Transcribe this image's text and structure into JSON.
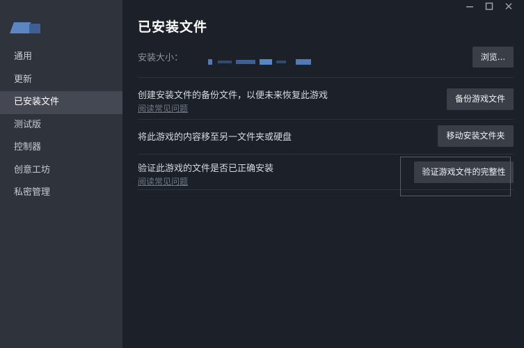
{
  "window": {
    "minimize_icon": "minimize-icon",
    "maximize_icon": "maximize-icon",
    "close_icon": "close-icon"
  },
  "sidebar": {
    "logo_icon": "game-logo-icon",
    "items": [
      {
        "label": "通用",
        "active": false
      },
      {
        "label": "更新",
        "active": false
      },
      {
        "label": "已安装文件",
        "active": true
      },
      {
        "label": "测试版",
        "active": false
      },
      {
        "label": "控制器",
        "active": false
      },
      {
        "label": "创意工坊",
        "active": false
      },
      {
        "label": "私密管理",
        "active": false
      }
    ]
  },
  "main": {
    "title": "已安装文件",
    "install_size": {
      "label": "安装大小：",
      "browse_label": "浏览..."
    },
    "backup": {
      "text": "创建安装文件的备份文件，以便未来恢复此游戏",
      "faq_link": "阅读常见问题",
      "button_label": "备份游戏文件"
    },
    "move": {
      "text": "将此游戏的内容移至另一文件夹或硬盘",
      "button_label": "移动安装文件夹"
    },
    "verify": {
      "text": "验证此游戏的文件是否已正确安装",
      "faq_link": "阅读常见问题",
      "button_label": "验证游戏文件的完整性"
    }
  },
  "colors": {
    "sidebar_bg": "#2f333c",
    "sidebar_active_bg": "#434853",
    "main_bg": "#1c2029",
    "button_bg": "#3a3e47",
    "highlight_border": "#c23232"
  }
}
